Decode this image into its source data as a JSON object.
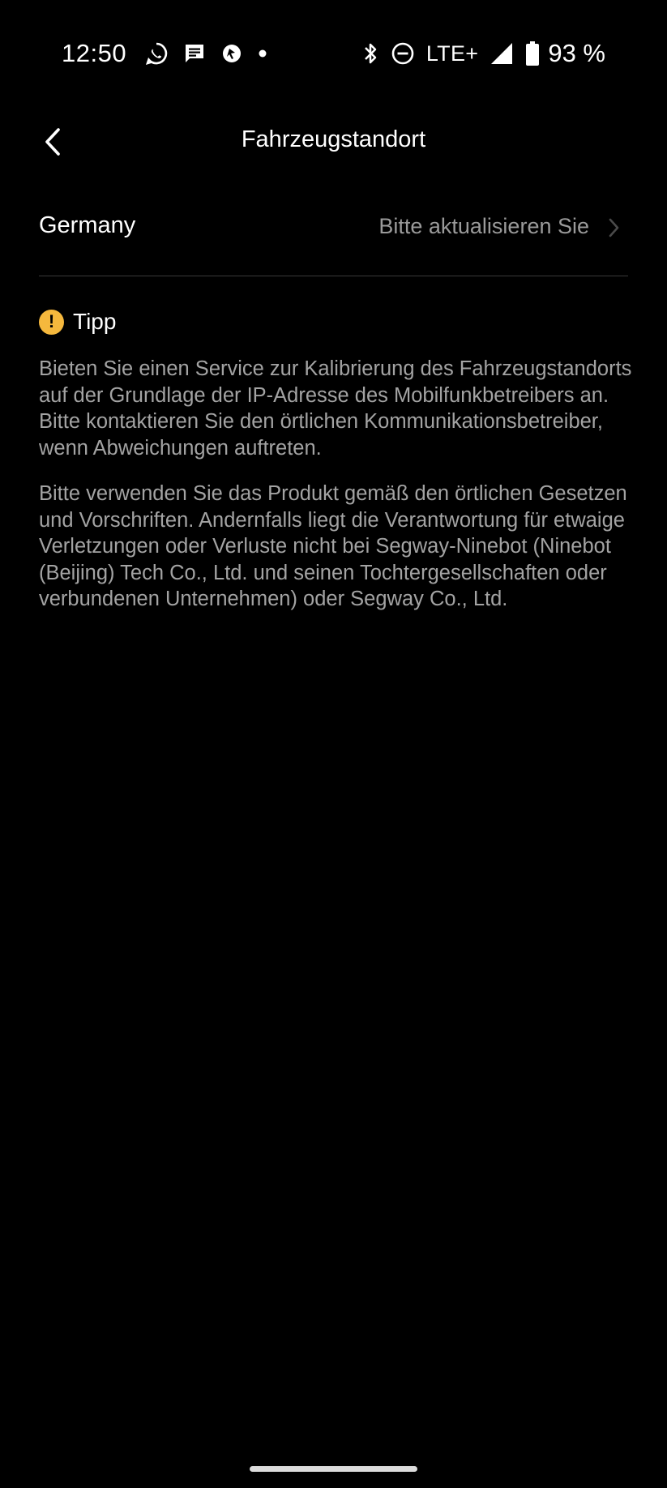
{
  "status_bar": {
    "time": "12:50",
    "network": "LTE+",
    "battery": "93 %",
    "left_icons": [
      "whatsapp-icon",
      "message-icon",
      "vpn-icon",
      "dot-icon"
    ],
    "right_icons": [
      "bluetooth-icon",
      "do-not-disturb-icon",
      "lte-icon",
      "signal-icon",
      "battery-icon"
    ]
  },
  "header": {
    "title": "Fahrzeugstandort",
    "back_icon": "chevron-left-icon"
  },
  "location_row": {
    "label": "Germany",
    "value": "Bitte aktualisieren Sie",
    "chevron_icon": "chevron-right-icon"
  },
  "tip": {
    "icon": "exclamation-icon",
    "title": "Tipp",
    "paragraphs": [
      "Bieten Sie einen Service zur Kalibrierung des Fahrzeugstandorts auf der Grundlage der IP-Adresse des Mobilfunkbetreibers an. Bitte kontaktieren Sie den örtlichen Kommunikationsbetreiber, wenn Abweichungen auftreten.",
      "Bitte verwenden Sie das Produkt gemäß den örtlichen Gesetzen und Vorschriften. Andernfalls liegt die Verantwortung für etwaige Verletzungen oder Verluste nicht bei Segway-Ninebot (Ninebot (Beijing) Tech Co., Ltd. und seinen Tochtergesellschaften oder verbundenen Unternehmen) oder Segway Co., Ltd."
    ]
  },
  "colors": {
    "background": "#000000",
    "primary_text": "#ffffff",
    "secondary_text": "#a3a3a3",
    "accent": "#f5b83d",
    "divider": "#3a3a3a"
  }
}
